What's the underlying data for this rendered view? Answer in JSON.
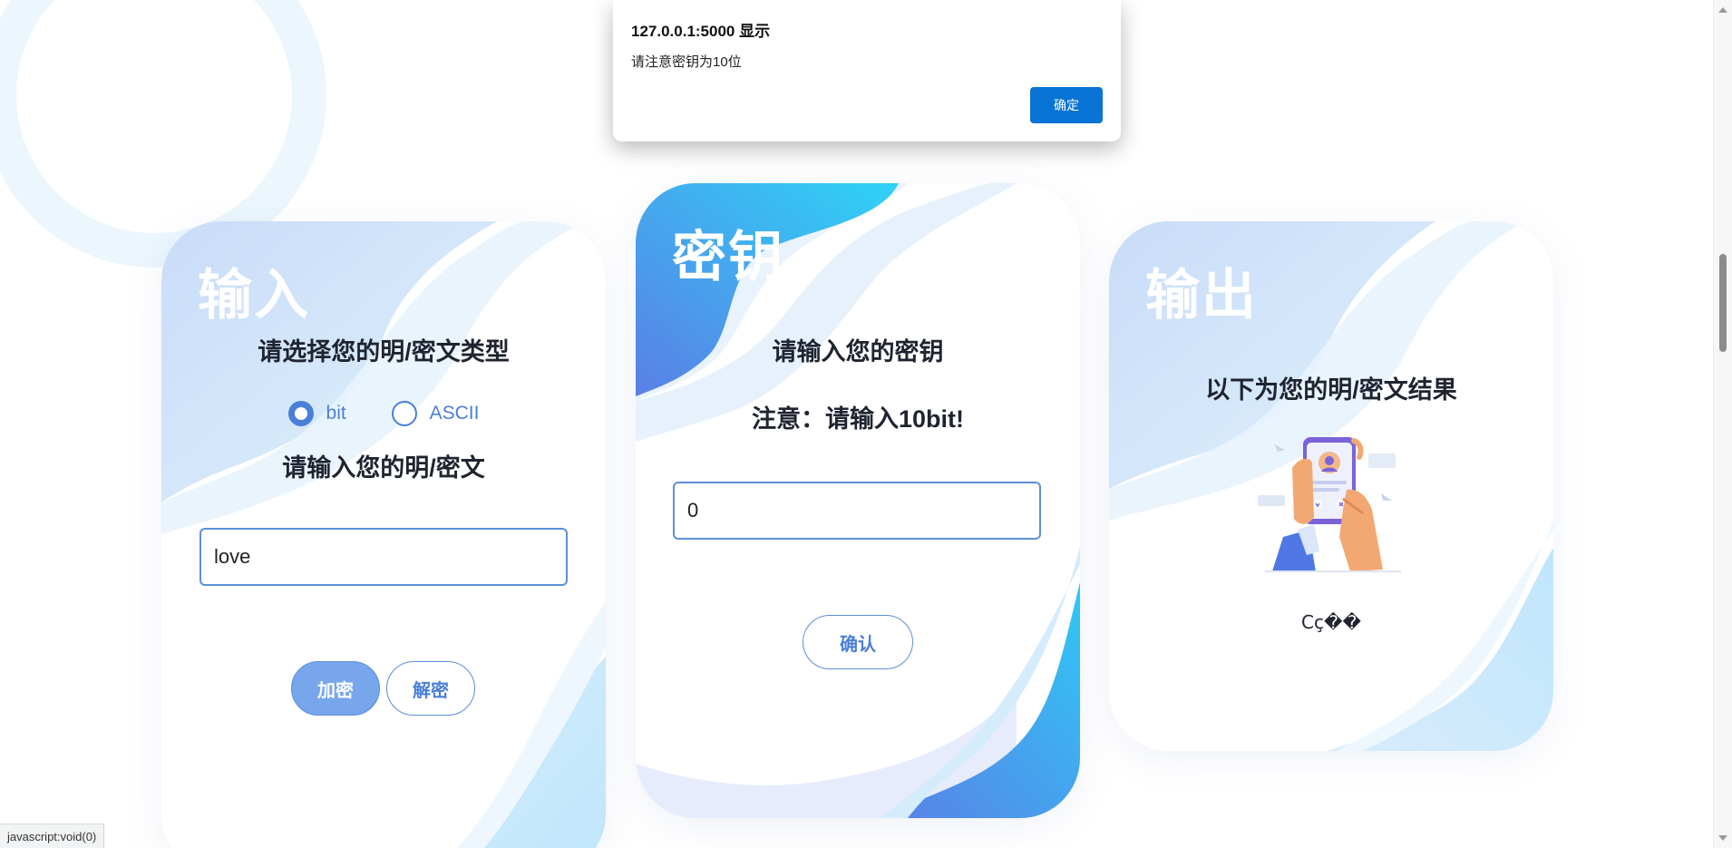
{
  "dialog": {
    "title": "127.0.0.1:5000 显示",
    "message": "请注意密钥为10位",
    "ok_label": "确定"
  },
  "input_card": {
    "title": "输入",
    "type_heading": "请选择您的明/密文类型",
    "radio_options": [
      {
        "label": "bit",
        "checked": true
      },
      {
        "label": "ASCII",
        "checked": false
      }
    ],
    "text_heading": "请输入您的明/密文",
    "text_value": "love",
    "encrypt_label": "加密",
    "decrypt_label": "解密"
  },
  "key_card": {
    "title": "密钥",
    "heading": "请输入您的密钥",
    "note": "注意：请输入10bit!",
    "key_value": "0",
    "confirm_label": "确认"
  },
  "output_card": {
    "title": "输出",
    "heading": "以下为您的明/密文结果",
    "result": "Cç��"
  },
  "status_bar": {
    "text": "javascript:void(0)"
  },
  "colors": {
    "accent": "#4a7fd8",
    "primary_button": "#77a6ec",
    "dialog_button": "#0a74d6"
  }
}
